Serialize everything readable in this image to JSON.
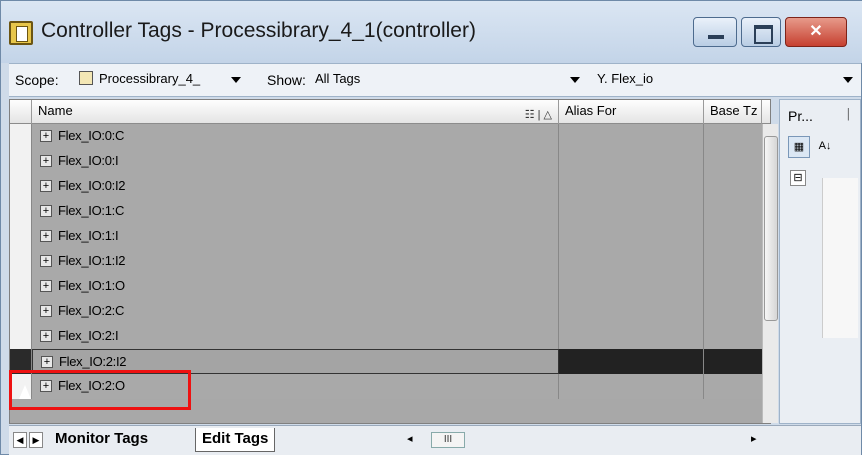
{
  "window": {
    "title": "Controller Tags - Processibrary_4_1(controller)",
    "min_glyph": "",
    "max_glyph": "",
    "close_glyph": "✕"
  },
  "toolbar": {
    "scope_label": "Scope:",
    "scope_value": "Processibrary_4_",
    "show_label": "Show:",
    "show_value": "All Tags",
    "filter_value": "Flex_io",
    "filter_icon": "Y."
  },
  "grid": {
    "columns": {
      "name": "Name",
      "alias": "Alias For",
      "base": "Base Tz"
    },
    "rows": [
      {
        "name": "Flex_IO:0:C"
      },
      {
        "name": "Flex_IO:0:I"
      },
      {
        "name": "Flex_IO:0:I2"
      },
      {
        "name": "Flex_IO:1:C"
      },
      {
        "name": "Flex_IO:1:I"
      },
      {
        "name": "Flex_IO:1:I2"
      },
      {
        "name": "Flex_IO:1:O"
      },
      {
        "name": "Flex_IO:2:C"
      },
      {
        "name": "Flex_IO:2:I"
      },
      {
        "name": "Flex_IO:2:I2"
      },
      {
        "name": "Flex_IO:2:O"
      }
    ],
    "selected_row": "Flex_IO:2:I2"
  },
  "tabs": {
    "monitor": "Monitor Tags",
    "edit": "Edit Tags"
  },
  "properties": {
    "title": "Pr...",
    "pin": "ᛁ",
    "sort_alpha": "A↓",
    "collapse": "⊟"
  },
  "hscroll_label": "III"
}
